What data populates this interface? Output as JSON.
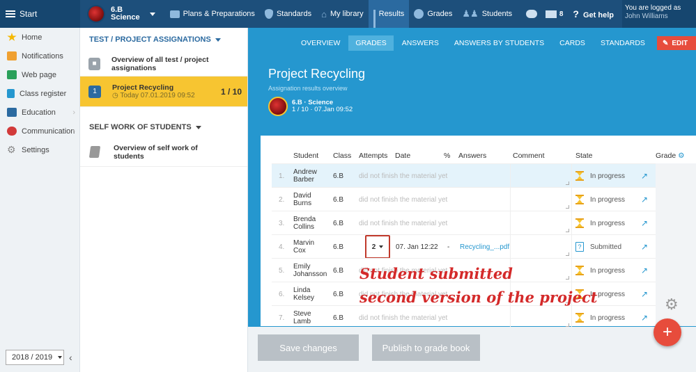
{
  "topbar": {
    "start": "Start",
    "class_line1": "6.B",
    "class_line2": "Science",
    "nav": [
      "Plans & Preparations",
      "Standards",
      "My library",
      "Results",
      "Grades",
      "Students"
    ],
    "mail_count": "8",
    "help": "Get help",
    "user_line1": "You are logged as",
    "user_name": "John Williams"
  },
  "leftmenu": {
    "items": [
      "Home",
      "Notifications",
      "Web page",
      "Class register",
      "Education",
      "Communication",
      "Settings"
    ],
    "icon_colors": [
      "#f5b800",
      "#f0a030",
      "#2aa05a",
      "#2597cf",
      "#2b6aa0",
      "#d23a3a",
      "#888888"
    ],
    "year": "2018 / 2019"
  },
  "assignments": {
    "header": "TEST / PROJECT ASSIGNATIONS",
    "overview": "Overview of all test / project assignations",
    "selected_badge": "1",
    "selected_title": "Project Recycling",
    "selected_sub": "Today 07.01.2019 09:52",
    "selected_count": "1 / 10",
    "self_header": "SELF WORK OF STUDENTS",
    "self_line1": "Overview of self work of",
    "self_line2": "students"
  },
  "main": {
    "tabs": [
      "OVERVIEW",
      "GRADES",
      "ANSWERS",
      "ANSWERS BY STUDENTS",
      "CARDS",
      "STANDARDS"
    ],
    "active_tab": "GRADES",
    "edit": "EDIT",
    "title": "Project Recycling",
    "subtitle": "Assignation results overview",
    "info_line1": "6.B · Science",
    "info_line2": "1 / 10 · 07.Jan 09:52"
  },
  "table": {
    "headers": {
      "student": "Student",
      "class": "Class",
      "attempts": "Attempts",
      "date": "Date",
      "percent": "%",
      "answers": "Answers",
      "comment": "Comment",
      "state": "State",
      "grade": "Grade"
    },
    "rows": [
      {
        "num": "1.",
        "first": "Andrew",
        "last": "Barber",
        "class": "6.B",
        "note": "did not finish the material yet",
        "state": "In progress"
      },
      {
        "num": "2.",
        "first": "David",
        "last": "Burns",
        "class": "6.B",
        "note": "did not finish the material yet",
        "state": "In progress"
      },
      {
        "num": "3.",
        "first": "Brenda",
        "last": "Collins",
        "class": "6.B",
        "note": "did not finish the material yet",
        "state": "In progress"
      },
      {
        "num": "4.",
        "first": "Marvin",
        "last": "Cox",
        "class": "6.B",
        "attempt": "2",
        "date": "07. Jan 12:22",
        "percent": "-",
        "answer": "Recycling_...pdf",
        "state": "Submitted"
      },
      {
        "num": "5.",
        "first": "Emily",
        "last": "Johansson",
        "class": "6.B",
        "note": "did not finish the material yet",
        "state": "In progress"
      },
      {
        "num": "6.",
        "first": "Linda",
        "last": "Kelsey",
        "class": "6.B",
        "note": "did not finish the material yet",
        "state": "In progress"
      },
      {
        "num": "7.",
        "first": "Steve",
        "last": "Lamb",
        "class": "6.B",
        "note": "did not finish the material yet",
        "state": "In progress"
      }
    ]
  },
  "annotation": {
    "line1": "Student submitted",
    "line2": "second version of the project"
  },
  "buttons": {
    "save": "Save changes",
    "publish": "Publish to grade book",
    "fab": "+"
  }
}
